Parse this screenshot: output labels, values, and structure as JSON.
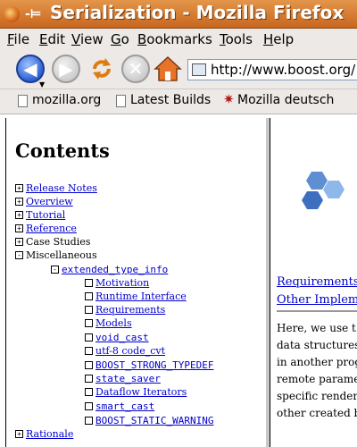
{
  "window": {
    "title": "Serialization - Mozilla Firefox",
    "pin_glyph": "-⊨"
  },
  "menu": [
    "File",
    "Edit",
    "View",
    "Go",
    "Bookmarks",
    "Tools",
    "Help"
  ],
  "nav": {
    "url": "http://www.boost.org/"
  },
  "bookmarks": [
    "mozilla.org",
    "Latest Builds",
    "Mozilla deutsch"
  ],
  "toc": {
    "title": "Contents",
    "items": [
      {
        "expander": "+",
        "label": "Release Notes",
        "link": true
      },
      {
        "expander": "+",
        "label": "Overview",
        "link": true
      },
      {
        "expander": "+",
        "label": "Tutorial",
        "link": true
      },
      {
        "expander": "+",
        "label": "Reference",
        "link": true
      },
      {
        "expander": "+",
        "label": "Case Studies",
        "link": false
      },
      {
        "expander": "-",
        "label": "Miscellaneous",
        "link": false
      },
      {
        "expander": "-",
        "label": "extended_type_info",
        "link": true,
        "mono": true
      },
      {
        "label": "Motivation",
        "link": true
      },
      {
        "label": "Runtime Interface",
        "link": true
      },
      {
        "label": "Requirements",
        "link": true
      },
      {
        "label": "Models",
        "link": true
      },
      {
        "label": "void_cast",
        "link": true,
        "mono": true
      },
      {
        "label": "utf-8 code_cvt",
        "link": true
      },
      {
        "label": "BOOST_STRONG_TYPEDEF",
        "link": true,
        "mono": true
      },
      {
        "label": "state_saver",
        "link": true,
        "mono": true
      },
      {
        "label": "Dataflow Iterators",
        "link": true
      },
      {
        "label": "smart_cast",
        "link": true,
        "mono": true
      },
      {
        "label": "BOOST_STATIC_WARNING",
        "link": true,
        "mono": true
      },
      {
        "expander": "+",
        "label": "Rationale",
        "link": true
      }
    ]
  },
  "main": {
    "links": [
      "Requirements",
      "Other Impleme"
    ],
    "paragraph": [
      "Here, we use t",
      "data structures",
      "in another prog",
      "remote parame",
      "specific render",
      "other created b"
    ]
  }
}
